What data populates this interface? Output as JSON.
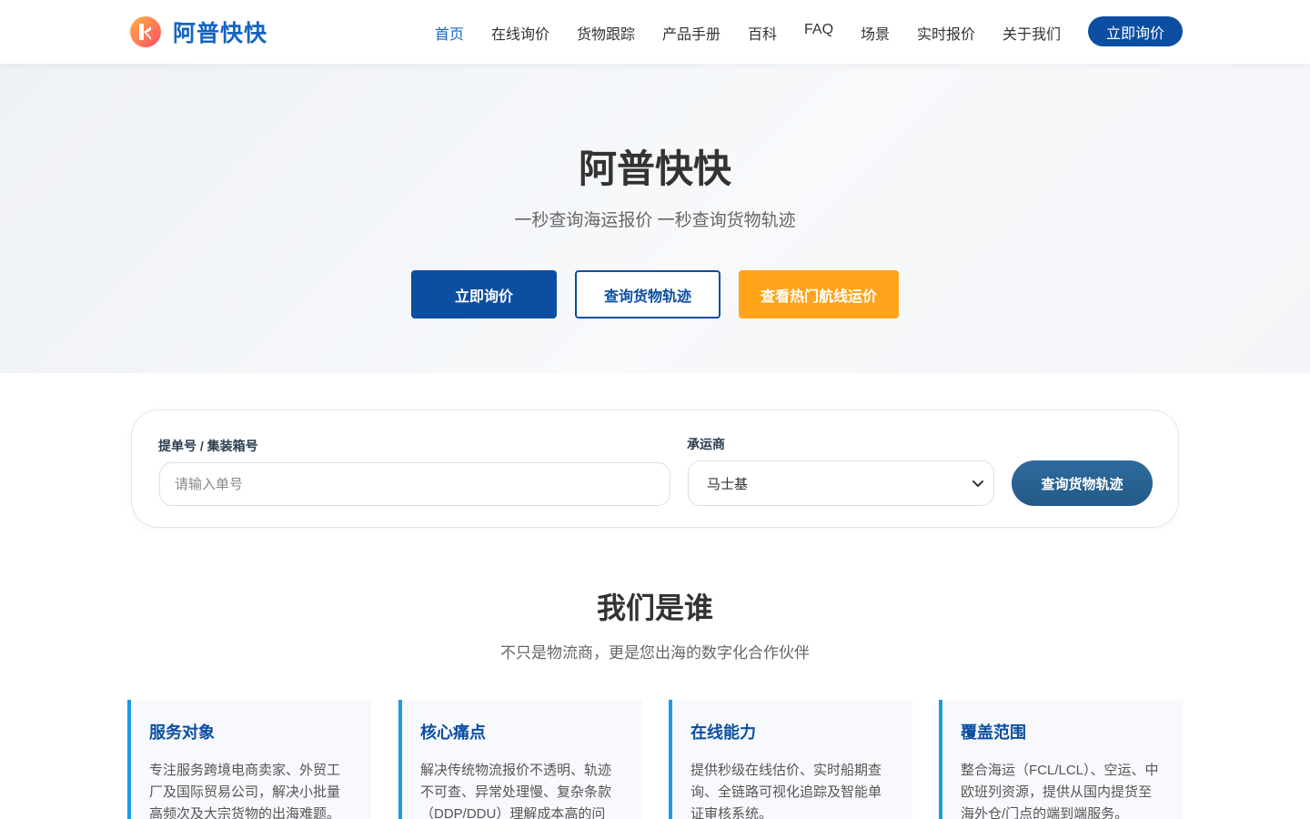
{
  "header": {
    "brand": "阿普快快",
    "nav": [
      "首页",
      "在线询价",
      "货物跟踪",
      "产品手册",
      "百科",
      "FAQ",
      "场景",
      "实时报价",
      "关于我们"
    ],
    "cta": "立即询价",
    "colors": {
      "primary": "#0b4ea2",
      "logo_gradient_start": "#ff5a5a",
      "logo_gradient_end": "#ffb23e"
    }
  },
  "hero": {
    "title": "阿普快快",
    "subtitle": "一秒查询海运报价 一秒查询货物轨迹",
    "btn_quote": "立即询价",
    "btn_track": "查询货物轨迹",
    "btn_routes": "查看热门航线运价",
    "colors": {
      "orange": "#ffa41b"
    }
  },
  "tracking": {
    "bl_label": "提单号 / 集装箱号",
    "bl_placeholder": "请输入单号",
    "carrier_label": "承运商",
    "carrier_selected": "马士基",
    "submit": "查询货物轨迹"
  },
  "about": {
    "title": "我们是谁",
    "subtitle": "不只是物流商，更是您出海的数字化合作伙伴",
    "cards": [
      {
        "title": "服务对象",
        "text": "专注服务跨境电商卖家、外贸工厂及国际贸易公司，解决小批量高频次及大宗货物的出海难题。"
      },
      {
        "title": "核心痛点",
        "text": "解决传统物流报价不透明、轨迹不可查、异常处理慢、复杂条款（DDP/DDU）理解成本高的问"
      },
      {
        "title": "在线能力",
        "text": "提供秒级在线估价、实时船期查询、全链路可视化追踪及智能单证审核系统。"
      },
      {
        "title": "覆盖范围",
        "text": "整合海运（FCL/LCL）、空运、中欧班列资源，提供从国内提货至海外仓/门点的端到端服务。"
      }
    ]
  }
}
